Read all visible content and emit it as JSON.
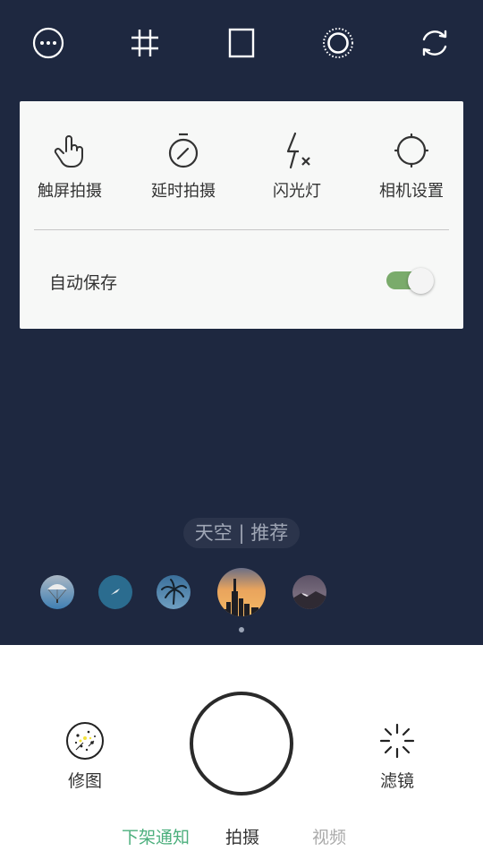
{
  "top_toolbar": {
    "icons": [
      "more-icon",
      "grid-icon",
      "aspect-ratio-icon",
      "live-photo-icon",
      "switch-camera-icon"
    ]
  },
  "settings_panel": {
    "options": [
      {
        "label": "触屏拍摄",
        "icon": "touch-capture-icon"
      },
      {
        "label": "延时拍摄",
        "icon": "timer-icon"
      },
      {
        "label": "闪光灯",
        "icon": "flash-off-icon"
      },
      {
        "label": "相机设置",
        "icon": "camera-settings-icon"
      }
    ],
    "auto_save": {
      "label": "自动保存",
      "enabled": true
    }
  },
  "scene": {
    "label": "天空 | 推荐",
    "thumbnails": [
      "parachute-sky",
      "bird-sky",
      "palm-sky",
      "city-sunset-sky",
      "mountain-dusk-sky"
    ],
    "selected_index": 3
  },
  "bottom_bar": {
    "edit_label": "修图",
    "filter_label": "滤镜",
    "modes": [
      {
        "label": "下架通知",
        "state": "highlight"
      },
      {
        "label": "拍摄",
        "state": "active"
      },
      {
        "label": "视频",
        "state": "inactive"
      }
    ]
  },
  "colors": {
    "background": "#1e2840",
    "panel": "#f7f8f7",
    "toggle_on": "#7aab6b",
    "mode_highlight": "#4caf7d",
    "mode_active": "#333333",
    "mode_inactive": "#aaaaaa"
  }
}
